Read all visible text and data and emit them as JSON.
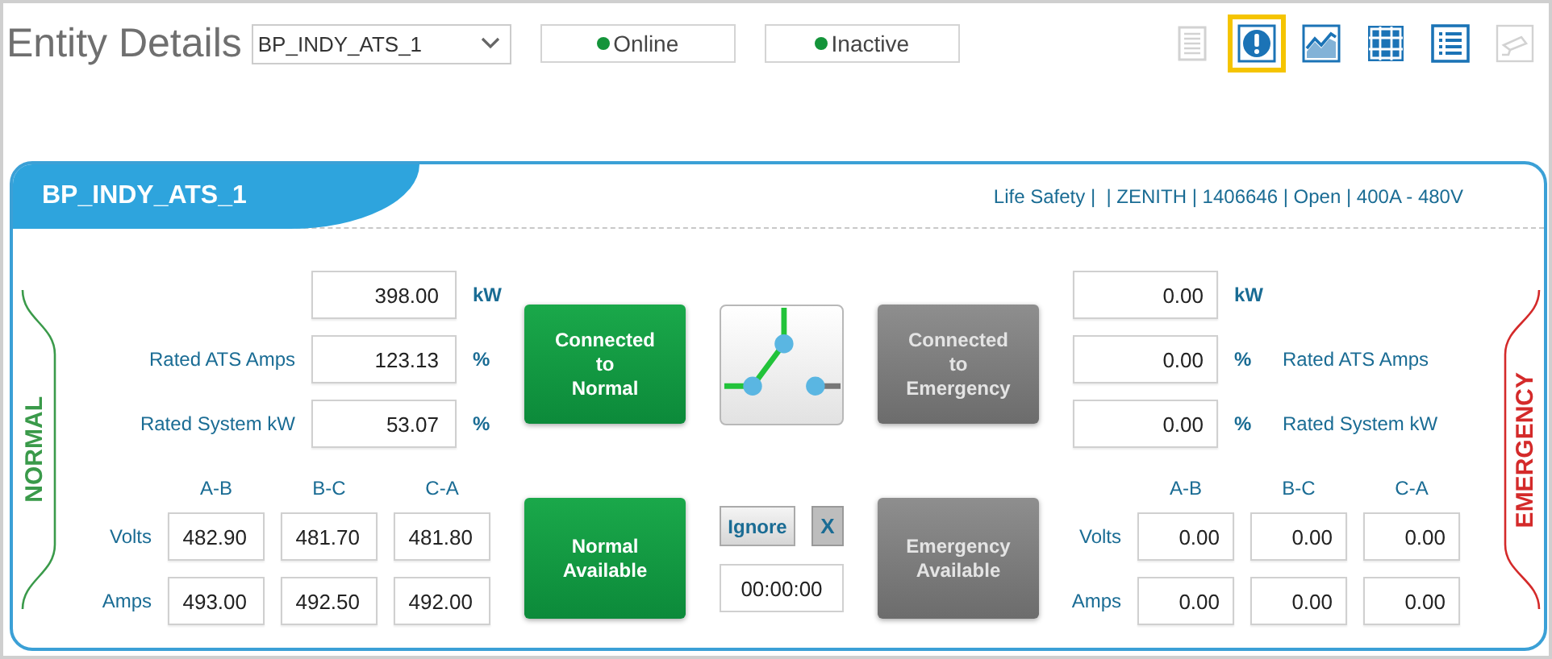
{
  "header": {
    "title": "Entity Details",
    "entity_select": {
      "value": "BP_INDY_ATS_1"
    },
    "statuses": [
      {
        "label": "Online"
      },
      {
        "label": "Inactive"
      }
    ]
  },
  "toolbar": [
    {
      "kind": "document",
      "selected": false,
      "disabled": true
    },
    {
      "kind": "alert",
      "selected": true,
      "disabled": false
    },
    {
      "kind": "trend",
      "selected": false,
      "disabled": false
    },
    {
      "kind": "grid",
      "selected": false,
      "disabled": false
    },
    {
      "kind": "list",
      "selected": false,
      "disabled": false
    },
    {
      "kind": "camera",
      "selected": false,
      "disabled": true
    }
  ],
  "panel": {
    "title": "BP_INDY_ATS_1",
    "info": "Life Safety |  | ZENITH | 1406646 | Open | 400A - 480V",
    "normal": {
      "label": "NORMAL",
      "metrics": [
        {
          "value": "398.00",
          "unit": "kW"
        },
        {
          "label": "Rated ATS Amps",
          "value": "123.13",
          "unit": "%"
        },
        {
          "label": "Rated System kW",
          "value": "53.07",
          "unit": "%"
        }
      ],
      "phases": {
        "columns": [
          "A-B",
          "B-C",
          "C-A"
        ],
        "rows": [
          {
            "label": "Volts",
            "values": [
              "482.90",
              "481.70",
              "481.80"
            ]
          },
          {
            "label": "Amps",
            "values": [
              "493.00",
              "492.50",
              "492.00"
            ]
          }
        ]
      },
      "connected_button": {
        "label": "Connected\nto\nNormal",
        "active": true
      },
      "available_button": {
        "label": "Normal\nAvailable",
        "active": true
      }
    },
    "emergency": {
      "label": "EMERGENCY",
      "metrics": [
        {
          "value": "0.00",
          "unit": "kW"
        },
        {
          "label": "Rated ATS Amps",
          "value": "0.00",
          "unit": "%"
        },
        {
          "label": "Rated System kW",
          "value": "0.00",
          "unit": "%"
        }
      ],
      "phases": {
        "columns": [
          "A-B",
          "B-C",
          "C-A"
        ],
        "rows": [
          {
            "label": "Volts",
            "values": [
              "0.00",
              "0.00",
              "0.00"
            ]
          },
          {
            "label": "Amps",
            "values": [
              "0.00",
              "0.00",
              "0.00"
            ]
          }
        ]
      },
      "connected_button": {
        "label": "Connected\nto\nEmergency",
        "active": false
      },
      "available_button": {
        "label": "Emergency\nAvailable",
        "active": false
      }
    },
    "transfer_switch": {
      "on_normal": true
    },
    "ignore_button": "Ignore",
    "clear_button": "X",
    "timer": "00:00:00"
  }
}
